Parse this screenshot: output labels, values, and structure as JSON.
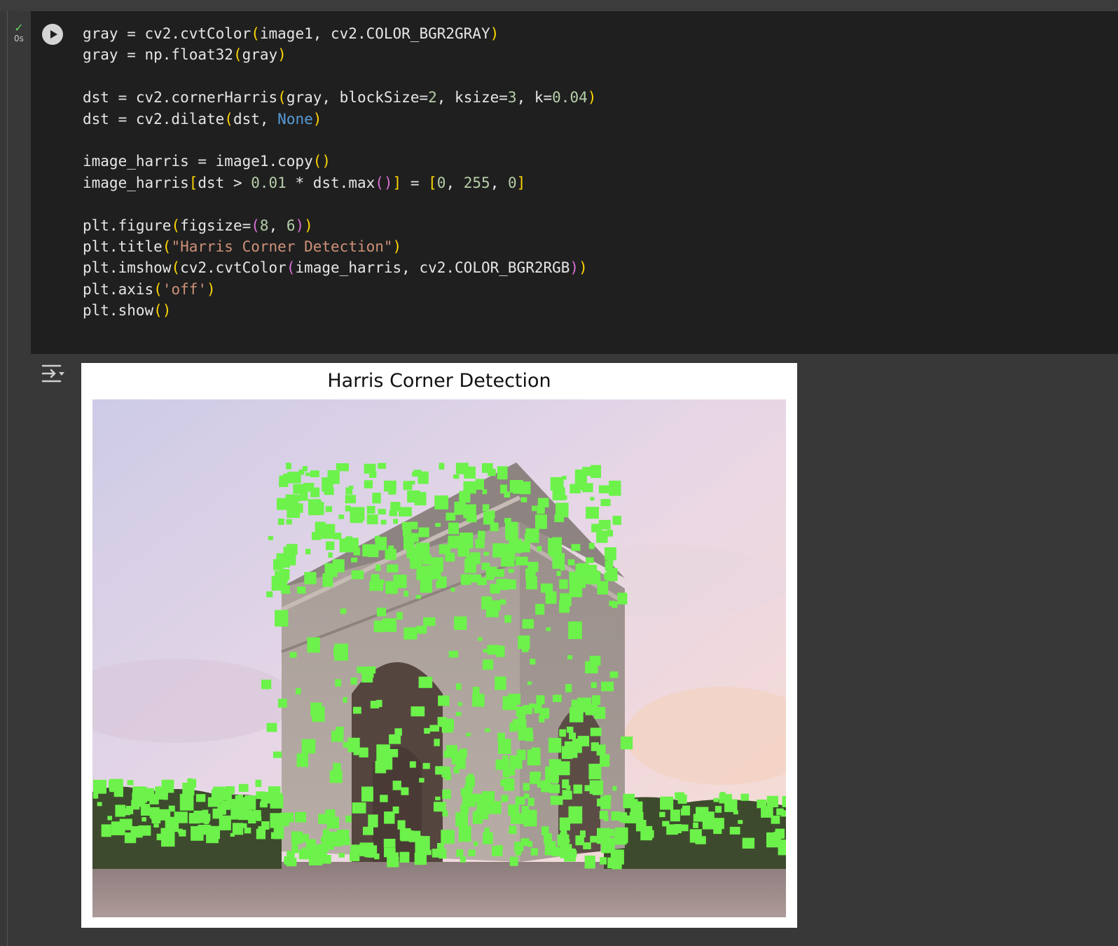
{
  "cell": {
    "status": {
      "check_icon": "check-icon",
      "exec_time": "0s"
    },
    "run_button": {
      "icon": "play-icon"
    },
    "code_lines": [
      [
        [
          "gray = cv2.cvtColor",
          ""
        ],
        [
          "(",
          "p1"
        ],
        [
          "image1, cv2.COLOR_BGR2GRAY",
          ""
        ],
        [
          ")",
          "p1"
        ]
      ],
      [
        [
          "gray = np.float32",
          ""
        ],
        [
          "(",
          "p1"
        ],
        [
          "gray",
          ""
        ],
        [
          ")",
          "p1"
        ]
      ],
      [],
      [
        [
          "dst = cv2.cornerHarris",
          ""
        ],
        [
          "(",
          "p1"
        ],
        [
          "gray, blockSize=",
          ""
        ],
        [
          "2",
          "num"
        ],
        [
          ", ksize=",
          ""
        ],
        [
          "3",
          "num"
        ],
        [
          ", k=",
          ""
        ],
        [
          "0.04",
          "num"
        ],
        [
          ")",
          "p1"
        ]
      ],
      [
        [
          "dst = cv2.dilate",
          ""
        ],
        [
          "(",
          "p1"
        ],
        [
          "dst, ",
          ""
        ],
        [
          "None",
          "kw"
        ],
        [
          ")",
          "p1"
        ]
      ],
      [],
      [
        [
          "image_harris = image1.copy",
          ""
        ],
        [
          "()",
          "p1"
        ]
      ],
      [
        [
          "image_harris",
          ""
        ],
        [
          "[",
          "p1"
        ],
        [
          "dst > ",
          ""
        ],
        [
          "0.01",
          "num"
        ],
        [
          " * dst.max",
          ""
        ],
        [
          "()",
          "p2"
        ],
        [
          "]",
          "p1"
        ],
        [
          " = ",
          ""
        ],
        [
          "[",
          "p1"
        ],
        [
          "0",
          "num"
        ],
        [
          ", ",
          ""
        ],
        [
          "255",
          "num"
        ],
        [
          ", ",
          ""
        ],
        [
          "0",
          "num"
        ],
        [
          "]",
          "p1"
        ]
      ],
      [],
      [
        [
          "plt.figure",
          ""
        ],
        [
          "(",
          "p1"
        ],
        [
          "figsize=",
          ""
        ],
        [
          "(",
          "p2"
        ],
        [
          "8",
          "num"
        ],
        [
          ", ",
          ""
        ],
        [
          "6",
          "num"
        ],
        [
          ")",
          "p2"
        ],
        [
          ")",
          "p1"
        ]
      ],
      [
        [
          "plt.title",
          ""
        ],
        [
          "(",
          "p1"
        ],
        [
          "\"Harris Corner Detection\"",
          "str"
        ],
        [
          ")",
          "p1"
        ]
      ],
      [
        [
          "plt.imshow",
          ""
        ],
        [
          "(",
          "p1"
        ],
        [
          "cv2.cvtColor",
          ""
        ],
        [
          "(",
          "p2"
        ],
        [
          "image_harris, cv2.COLOR_BGR2RGB",
          ""
        ],
        [
          ")",
          "p2"
        ],
        [
          ")",
          "p1"
        ]
      ],
      [
        [
          "plt.axis",
          ""
        ],
        [
          "(",
          "p1"
        ],
        [
          "'off'",
          "str"
        ],
        [
          ")",
          "p1"
        ]
      ],
      [
        [
          "plt.show",
          ""
        ],
        [
          "()",
          "p1"
        ]
      ]
    ]
  },
  "output": {
    "toggle_icon": "output-toggle-icon",
    "figure_title": "Harris Corner Detection",
    "image_description_icon": "arc-de-triomphe-photo"
  },
  "colors": {
    "background": "#383838",
    "code_background": "#1f1f1f",
    "code_text": "#e6e6e6",
    "number": "#b5cea8",
    "keyword": "#569cd6",
    "string": "#ce9178",
    "bracket1": "#ffd700",
    "bracket2": "#da70d6",
    "status_ok": "#5fd35f",
    "corner_marks": "#6cf24a"
  }
}
